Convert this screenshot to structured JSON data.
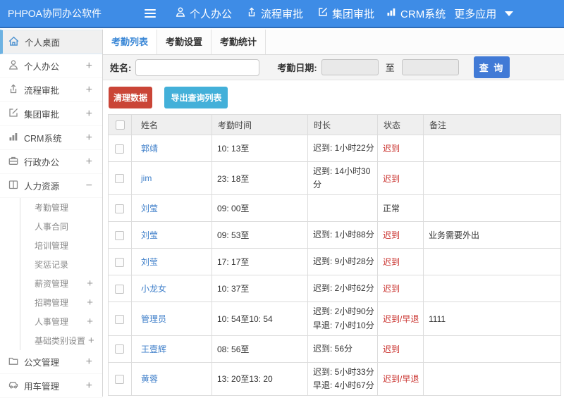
{
  "topbar": {
    "logo": "PHPOA协同办公软件",
    "nav": [
      {
        "label": "个人办公",
        "icon": "person-icon"
      },
      {
        "label": "流程审批",
        "icon": "workflow-icon"
      },
      {
        "label": "集团审批",
        "icon": "edit-icon"
      },
      {
        "label": "CRM系统",
        "icon": "chart-icon"
      },
      {
        "label": "更多应用",
        "icon": "caret-down-icon"
      }
    ]
  },
  "sidebar": {
    "items": [
      {
        "label": "个人桌面",
        "icon": "home-icon",
        "active": true,
        "suffix": ""
      },
      {
        "label": "个人办公",
        "icon": "person-icon",
        "suffix": "+"
      },
      {
        "label": "流程审批",
        "icon": "workflow-icon",
        "suffix": "+"
      },
      {
        "label": "集团审批",
        "icon": "edit-icon",
        "suffix": "+"
      },
      {
        "label": "CRM系统",
        "icon": "chart-icon",
        "suffix": "+"
      },
      {
        "label": "行政办公",
        "icon": "briefcase-icon",
        "suffix": "+"
      },
      {
        "label": "人力资源",
        "icon": "book-icon",
        "suffix": "−",
        "expanded": true
      }
    ],
    "submenu": [
      {
        "label": "考勤管理",
        "suffix": ""
      },
      {
        "label": "人事合同",
        "suffix": ""
      },
      {
        "label": "培训管理",
        "suffix": ""
      },
      {
        "label": "奖惩记录",
        "suffix": ""
      },
      {
        "label": "薪资管理",
        "suffix": "+"
      },
      {
        "label": "招聘管理",
        "suffix": "+"
      },
      {
        "label": "人事管理",
        "suffix": "+"
      },
      {
        "label": "基础类别设置",
        "suffix": "+"
      }
    ],
    "items_after": [
      {
        "label": "公文管理",
        "icon": "folder-icon",
        "suffix": "+"
      },
      {
        "label": "用车管理",
        "icon": "car-icon",
        "suffix": "+"
      }
    ]
  },
  "tabs": [
    "考勤列表",
    "考勤设置",
    "考勤统计"
  ],
  "filter": {
    "name_label": "姓名:",
    "name_value": "",
    "date_label": "考勤日期:",
    "date_from_value": "",
    "to_label": "至",
    "date_to_value": "",
    "search_label": "查 询"
  },
  "actions": {
    "clean_label": "清理数据",
    "export_label": "导出查询列表"
  },
  "table": {
    "columns": [
      "姓名",
      "考勤时间",
      "时长",
      "状态",
      "备注"
    ],
    "status_red_color": "#c9302c",
    "rows": [
      {
        "name": "郭靖",
        "time": "10: 13至",
        "duration": "迟到: 1小时22分",
        "status": "迟到",
        "red": true,
        "note": ""
      },
      {
        "name": "jim",
        "time": "23: 18至",
        "duration": "迟到: 14小时30分",
        "status": "迟到",
        "red": true,
        "note": ""
      },
      {
        "name": "刘莹",
        "time": "09: 00至",
        "duration": "",
        "status": "正常",
        "red": false,
        "note": ""
      },
      {
        "name": "刘莹",
        "time": "09: 53至",
        "duration": "迟到: 1小时88分",
        "status": "迟到",
        "red": true,
        "note": "业务需要外出"
      },
      {
        "name": "刘莹",
        "time": "17: 17至",
        "duration": "迟到: 9小时28分",
        "status": "迟到",
        "red": true,
        "note": ""
      },
      {
        "name": "小龙女",
        "time": "10: 37至",
        "duration": "迟到: 2小时62分",
        "status": "迟到",
        "red": true,
        "note": ""
      },
      {
        "name": "管理员",
        "time": "10: 54至10: 54",
        "duration": "迟到: 2小时90分\n早退: 7小时10分",
        "status": "迟到/早退",
        "red": true,
        "note": "1111"
      },
      {
        "name": "王壹辉",
        "time": "08: 56至",
        "duration": "迟到: 56分",
        "status": "迟到",
        "red": true,
        "note": ""
      },
      {
        "name": "黄蓉",
        "time": "13: 20至13: 20",
        "duration": "迟到: 5小时33分\n早退: 4小时67分",
        "status": "迟到/早退",
        "red": true,
        "note": ""
      }
    ]
  }
}
